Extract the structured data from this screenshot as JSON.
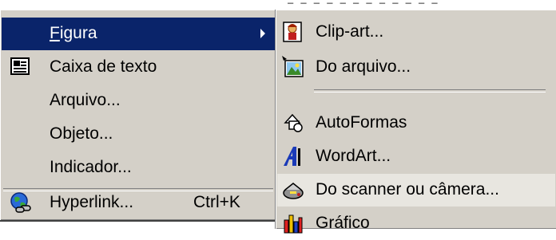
{
  "background_text": "— — — — — — — — — — — —",
  "colors": {
    "menu_bg": "#d4d0c8",
    "highlight": "#0a246a",
    "highlight_text": "#ffffff"
  },
  "insert_menu": {
    "items": [
      {
        "label": "Figura",
        "icon": "none",
        "has_submenu": true,
        "highlighted": true
      },
      {
        "label": "Caixa de texto",
        "icon": "text-box-icon"
      },
      {
        "label": "Arquivo...",
        "icon": "none"
      },
      {
        "label": "Objeto...",
        "icon": "none"
      },
      {
        "label": "Indicador...",
        "icon": "none"
      },
      {
        "label": "Hyperlink...",
        "shortcut": "Ctrl+K",
        "icon": "hyperlink-globe-icon"
      }
    ]
  },
  "figura_submenu": {
    "items": [
      {
        "label": "Clip-art...",
        "icon": "clip-art-icon"
      },
      {
        "label": "Do arquivo...",
        "icon": "picture-from-file-icon"
      },
      {
        "label": "AutoFormas",
        "icon": "autoshapes-icon"
      },
      {
        "label": "WordArt...",
        "icon": "wordart-icon"
      },
      {
        "label": "Do scanner ou câmera...",
        "icon": "scanner-icon",
        "pressed": true
      },
      {
        "label": "Gráfico",
        "icon": "chart-icon"
      }
    ]
  }
}
